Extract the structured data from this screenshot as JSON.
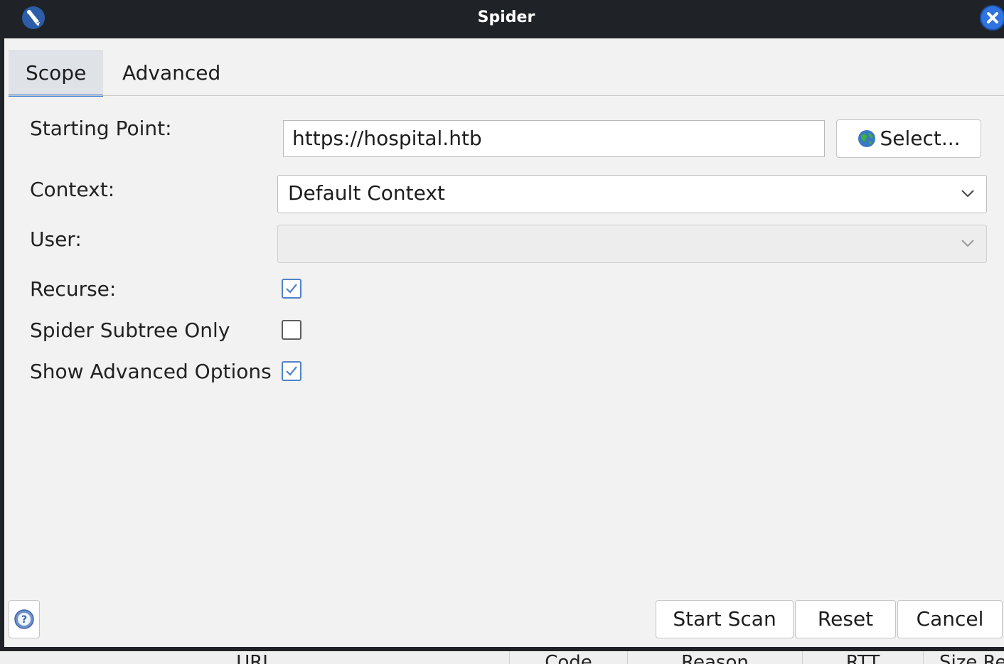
{
  "window": {
    "title": "Spider"
  },
  "tabs": [
    {
      "label": "Scope",
      "active": true
    },
    {
      "label": "Advanced",
      "active": false
    }
  ],
  "form": {
    "starting_point": {
      "label": "Starting Point:",
      "value": "https://hospital.htb",
      "select_button": "Select..."
    },
    "context": {
      "label": "Context:",
      "value": "Default Context"
    },
    "user": {
      "label": "User:",
      "value": ""
    },
    "recurse": {
      "label": "Recurse:",
      "checked": true
    },
    "subtree_only": {
      "label": "Spider Subtree Only",
      "checked": false
    },
    "show_advanced": {
      "label": "Show Advanced Options",
      "checked": true
    }
  },
  "footer": {
    "start_scan": "Start Scan",
    "reset": "Reset",
    "cancel": "Cancel"
  },
  "background_table": {
    "columns": [
      "URL",
      "Code",
      "Reason",
      "RTT",
      "Size Re"
    ]
  },
  "colors": {
    "titlebar": "#1f2327",
    "accent": "#3f7fd0",
    "close": "#2f74e0"
  }
}
